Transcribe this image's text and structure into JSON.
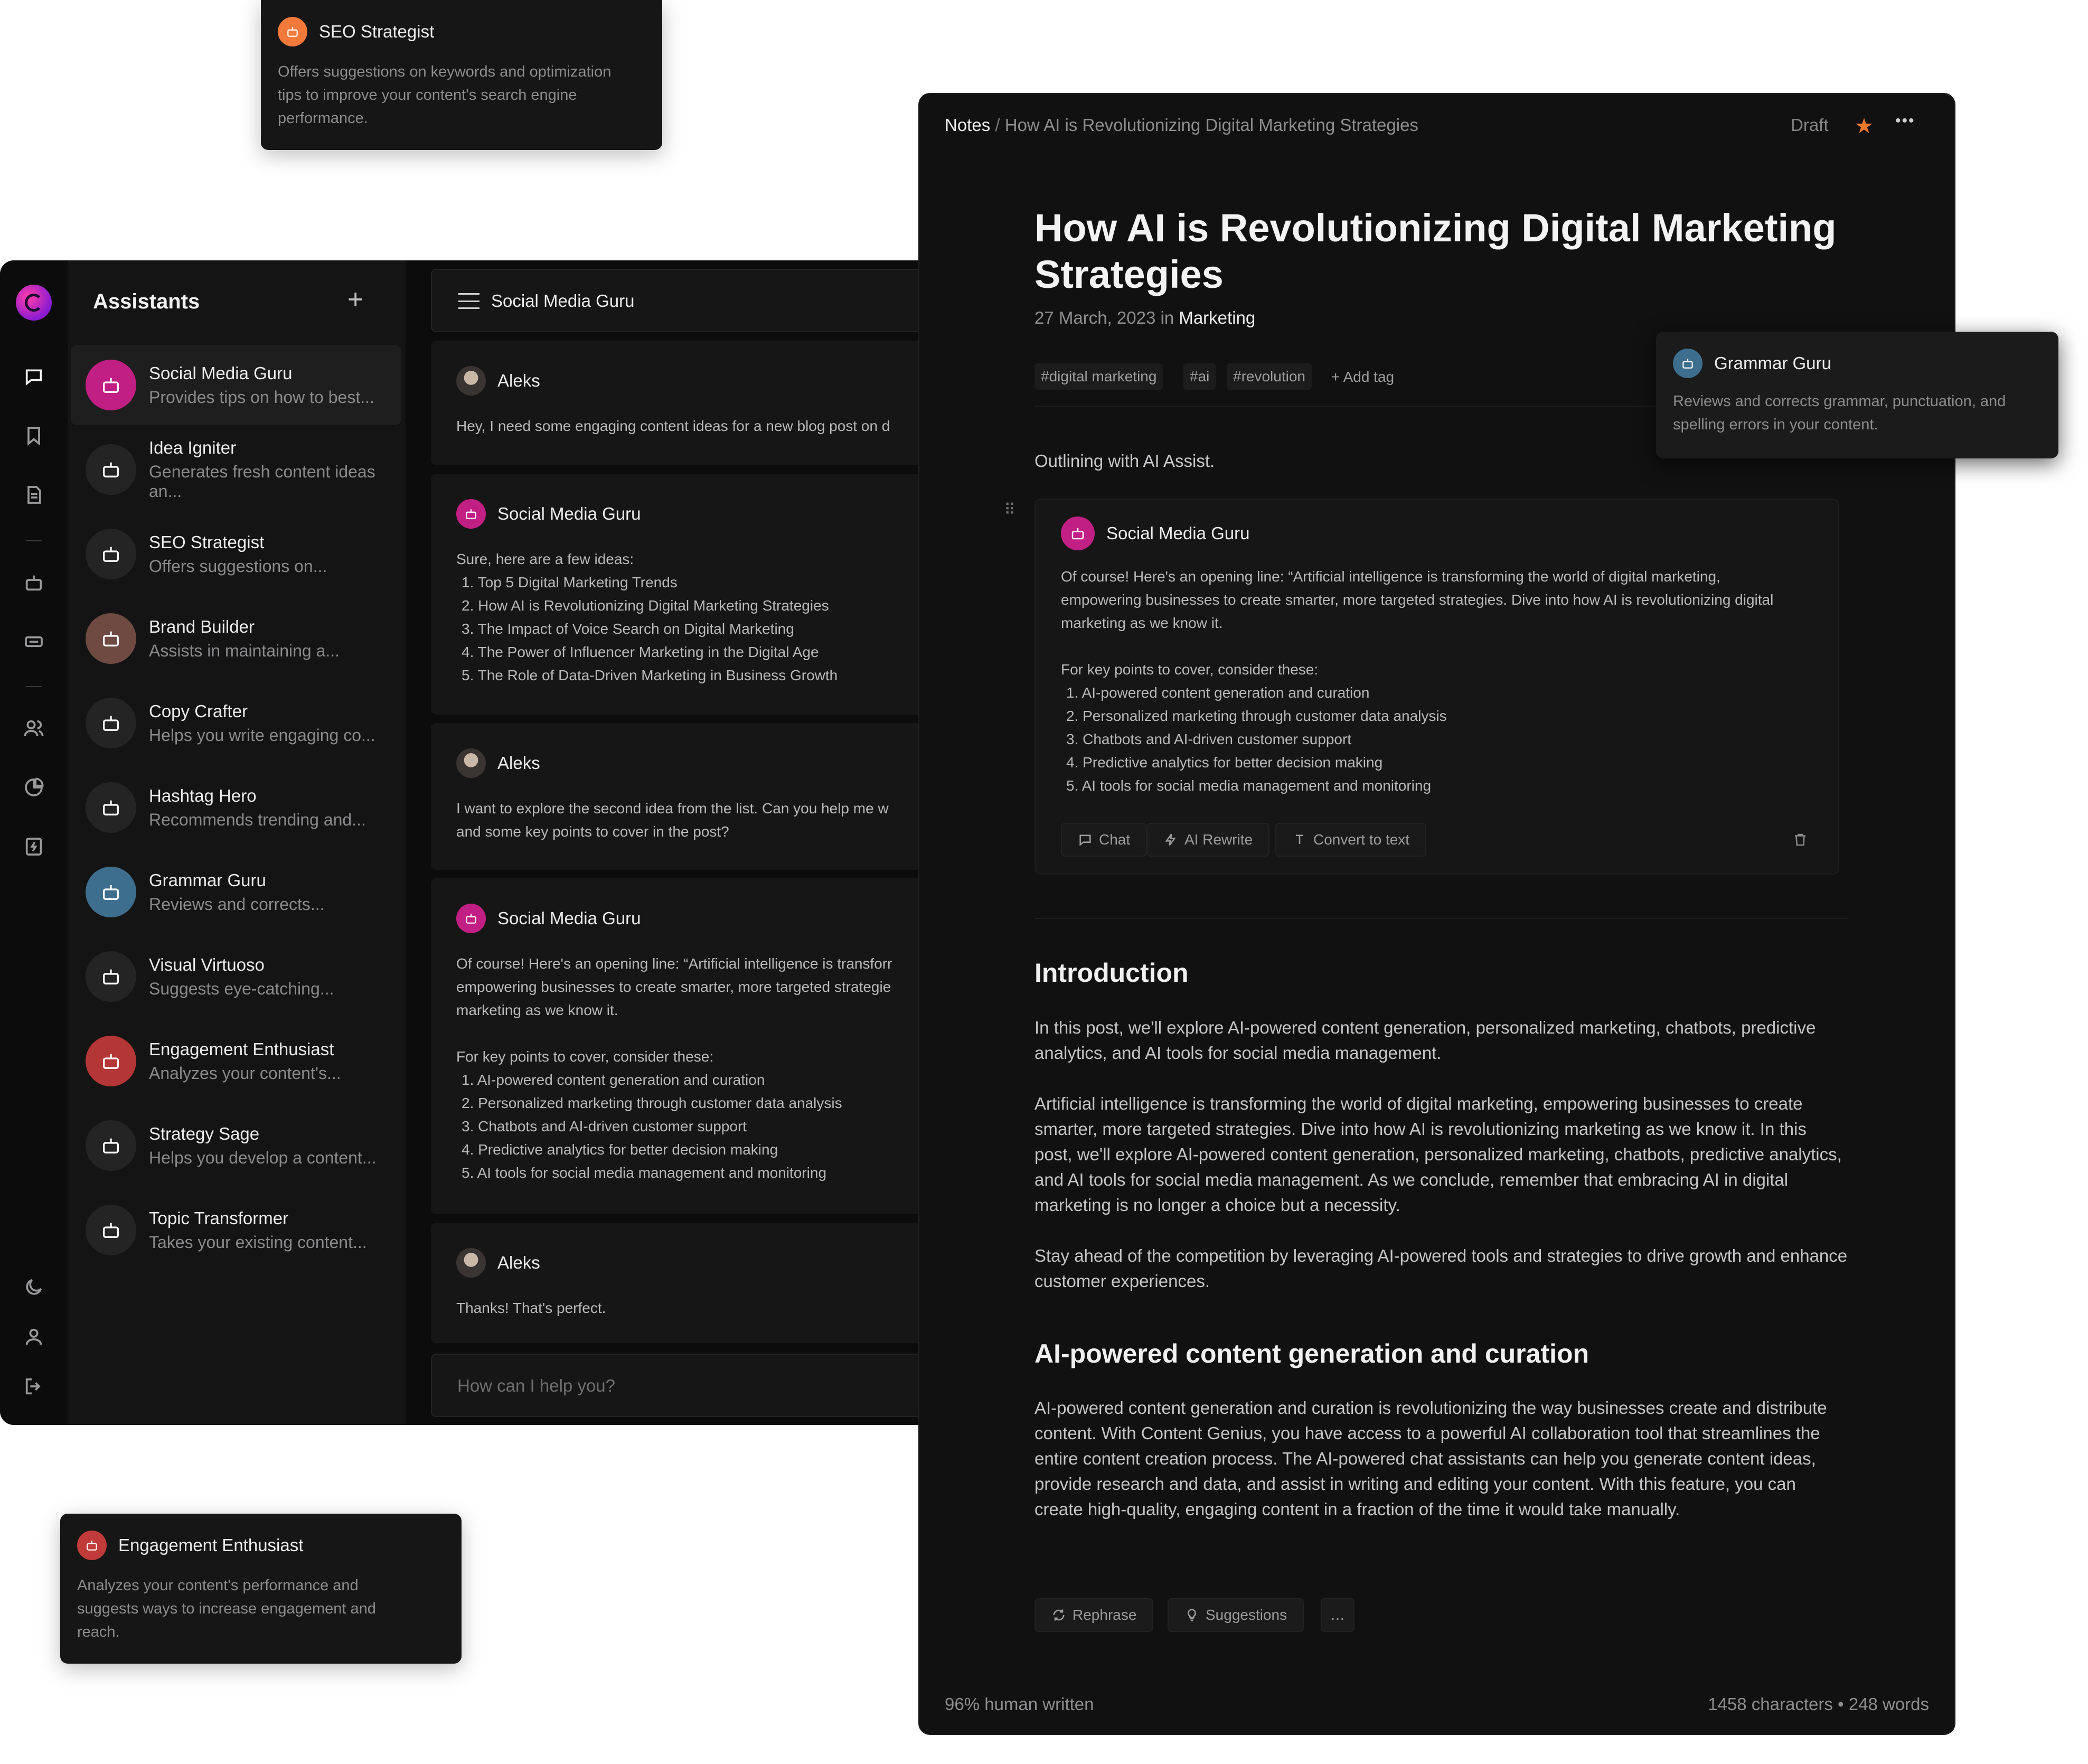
{
  "tooltips": {
    "seo": {
      "title": "SEO Strategist",
      "desc": "Offers suggestions on keywords and optimization tips to improve your content's search engine performance.",
      "color": "#f2793a"
    },
    "grammar": {
      "title": "Grammar Guru",
      "desc": "Reviews and corrects grammar, punctuation, and spelling errors in your content.",
      "color": "#3e6e8e"
    },
    "engagement": {
      "title": "Engagement Enthusiast",
      "desc": "Analyzes your content's performance and suggests ways to increase engagement and reach.",
      "color": "#c23b3b"
    }
  },
  "rail": {
    "logo": "gradient-logo",
    "icons": [
      "chat-bubble-icon",
      "bookmark-icon",
      "document-icon",
      "robot-icon",
      "keyboard-icon",
      "users-icon",
      "pie-chart-icon",
      "spark-icon",
      "moon-icon",
      "user-icon",
      "logout-icon"
    ]
  },
  "assistants": {
    "title": "Assistants",
    "add_label": "+",
    "items": [
      {
        "name": "Social Media Guru",
        "desc": "Provides tips on how to best...",
        "color": "#c21f85",
        "active": true
      },
      {
        "name": "Idea Igniter",
        "desc": "Generates fresh content ideas an...",
        "color": "#242424"
      },
      {
        "name": "SEO Strategist",
        "desc": "Offers suggestions on...",
        "color": "#242424"
      },
      {
        "name": "Brand Builder",
        "desc": "Assists in maintaining a...",
        "color": "#6e4a42"
      },
      {
        "name": "Copy Crafter",
        "desc": "Helps you write engaging co...",
        "color": "#242424"
      },
      {
        "name": "Hashtag Hero",
        "desc": "Recommends trending and...",
        "color": "#242424"
      },
      {
        "name": "Grammar Guru",
        "desc": "Reviews and corrects...",
        "color": "#3e6e8e"
      },
      {
        "name": "Visual Virtuoso",
        "desc": "Suggests eye-catching...",
        "color": "#242424"
      },
      {
        "name": "Engagement Enthusiast",
        "desc": "Analyzes your content's...",
        "color": "#b53636"
      },
      {
        "name": "Strategy Sage",
        "desc": "Helps you develop a content...",
        "color": "#242424"
      },
      {
        "name": "Topic Transformer",
        "desc": "Takes your existing content...",
        "color": "#242424"
      }
    ]
  },
  "chat": {
    "header_title": "Social Media Guru",
    "messages": [
      {
        "author": "Aleks",
        "lines": [
          "Hey, I need some engaging content ideas for a new blog post on d"
        ]
      },
      {
        "author": "Social Media Guru",
        "lines": [
          "Sure, here are a few ideas:",
          "1. Top 5 Digital Marketing Trends",
          "2. How AI is Revolutionizing Digital Marketing Strategies",
          "3. The Impact of Voice Search on Digital Marketing",
          "4. The Power of Influencer Marketing in the Digital Age",
          "5. The Role of Data-Driven Marketing in Business Growth"
        ]
      },
      {
        "author": "Aleks",
        "lines": [
          "I want to explore the second idea from the list. Can you help me w",
          "and some key points to cover in the post?"
        ]
      },
      {
        "author": "Social Media Guru",
        "lines": [
          "Of course! Here's an opening line: “Artificial intelligence is transforr",
          "empowering businesses to create smarter, more targeted strategie",
          "marketing as we know it.",
          "",
          "For key points to cover, consider these:",
          "1. AI-powered content generation and curation",
          "2. Personalized marketing through customer data analysis",
          "3. Chatbots and AI-driven customer support",
          "4. Predictive analytics for better decision making",
          "5. AI tools for social media management and monitoring"
        ]
      },
      {
        "author": "Aleks",
        "lines": [
          "Thanks! That's perfect."
        ]
      }
    ],
    "input_placeholder": "How can I help you?"
  },
  "notes": {
    "breadcrumb_root": "Notes",
    "breadcrumb_sep": "/",
    "breadcrumb_current": "How AI is Revolutionizing Digital Marketing Strategies",
    "status": "Draft",
    "more": "•••",
    "title_line1": "How AI is Revolutionizing Digital Marketing",
    "title_line2": "Strategies",
    "date": "27 March, 2023",
    "date_in": "in",
    "category": "Marketing",
    "tags": [
      "#digital marketing",
      "#ai",
      "#revolution"
    ],
    "add_tag": "+ Add tag",
    "outline_label": "Outlining with AI Assist.",
    "ai_card": {
      "name": "Social Media Guru",
      "lines": [
        "Of course! Here's an opening line: “Artificial intelligence is transforming the world of digital marketing,",
        "empowering businesses to create smarter, more targeted strategies. Dive into how AI is revolutionizing digital",
        "marketing as we know it.",
        "",
        "For key points to cover, consider these:",
        "1. AI-powered content generation and curation",
        "2. Personalized marketing through customer data analysis",
        "3. Chatbots and AI-driven customer support",
        "4. Predictive analytics for better decision making",
        "5. AI tools for social media management and monitoring"
      ],
      "actions": [
        "Chat",
        "AI Rewrite",
        "Convert to text"
      ]
    },
    "intro_heading": "Introduction",
    "intro_p1": "In this post, we'll explore AI-powered content generation, personalized marketing, chatbots, predictive analytics, and AI tools for social media management.",
    "intro_p2": "Artificial intelligence is transforming the world of digital marketing, empowering businesses to create smarter, more targeted strategies. Dive into how AI is revolutionizing marketing as we know it. In this post, we'll explore AI-powered content generation, personalized marketing, chatbots, predictive analytics, and AI tools for social media management. As we conclude, remember that embracing AI in digital marketing is no longer a choice but a necessity.",
    "intro_p3": "Stay ahead of the competition by leveraging AI-powered tools and strategies to drive growth and enhance customer experiences.",
    "section2_heading": "AI-powered content generation and curation",
    "section2_p1": "AI-powered content generation and curation is revolutionizing the way businesses create and distribute content. With Content Genius, you have access to a powerful AI collaboration tool that streamlines the entire content creation process. The AI-powered chat assistants can help you generate content ideas, provide research and data, and assist in writing and editing your content. With this feature, you can create high-quality, engaging content in a fraction of the time it would take manually.",
    "bottom_actions": [
      "Rephrase",
      "Suggestions",
      "…"
    ],
    "footer_left": "96% human written",
    "footer_right": "1458 characters • 248 words",
    "star_color": "#f27a2a"
  }
}
